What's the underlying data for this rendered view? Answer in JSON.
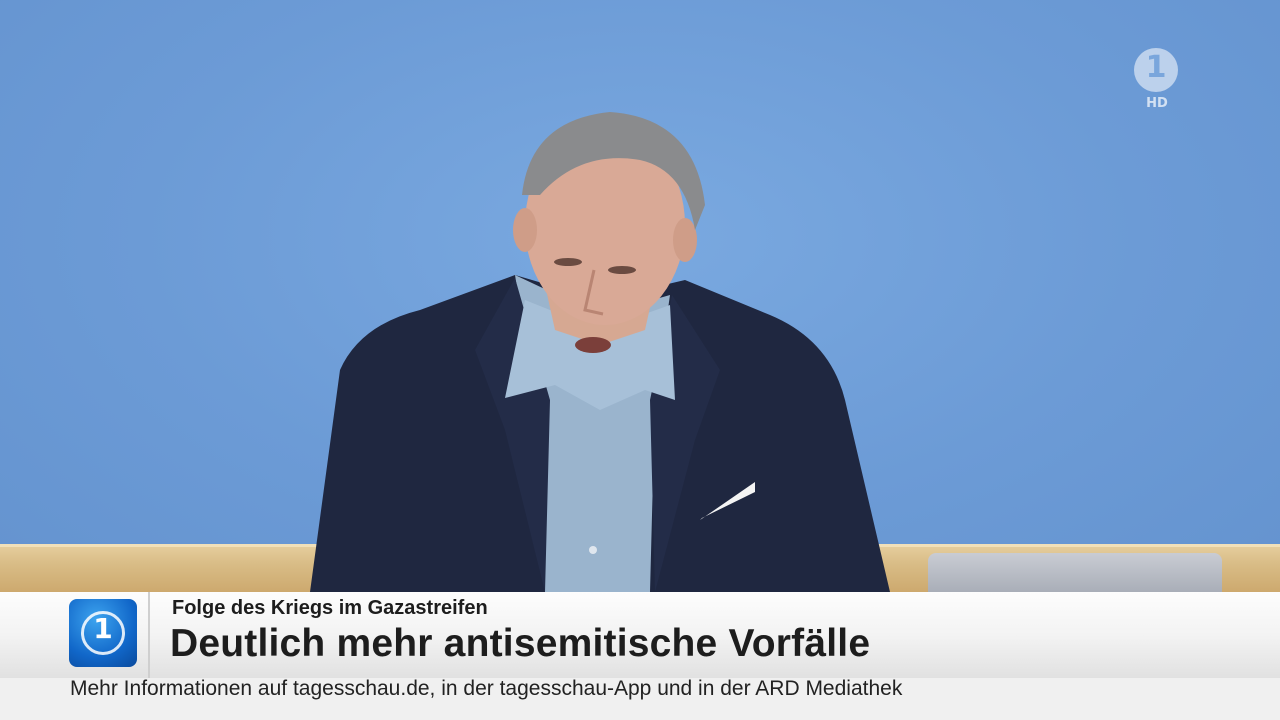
{
  "broadcast": {
    "channel_logo": {
      "number": "1",
      "badge": "HD",
      "icon": "ard-das-erste-logo"
    },
    "show_logo": {
      "number": "1",
      "icon": "tagesschau-logo"
    }
  },
  "lower_third": {
    "kicker": "Folge des Kriegs im Gazastreifen",
    "headline": "Deutlich mehr antisemitische Vorfälle"
  },
  "ticker": {
    "text": "Mehr Informationen auf tagesschau.de, in der tagesschau-App und in der ARD Mediathek"
  },
  "colors": {
    "backdrop_blue": "#6d9fd8",
    "tagesschau_blue": "#1167c9",
    "text_dark": "#1d1d1d"
  }
}
